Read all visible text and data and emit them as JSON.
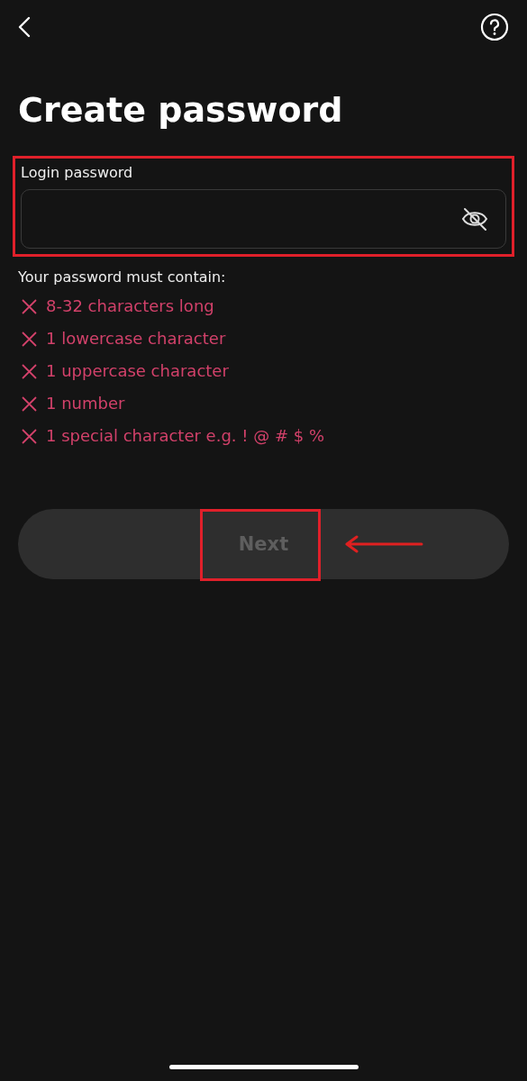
{
  "title": "Create password",
  "password_field": {
    "label": "Login password",
    "masked": true
  },
  "requirements_heading": "Your password must contain:",
  "requirements": [
    {
      "text": "8-32 characters long",
      "met": false
    },
    {
      "text": "1 lowercase character",
      "met": false
    },
    {
      "text": "1 uppercase character",
      "met": false
    },
    {
      "text": "1 number",
      "met": false
    },
    {
      "text": "1 special character e.g. ! @ # $ %",
      "met": false
    }
  ],
  "next_button": {
    "label": "Next",
    "disabled": true
  }
}
